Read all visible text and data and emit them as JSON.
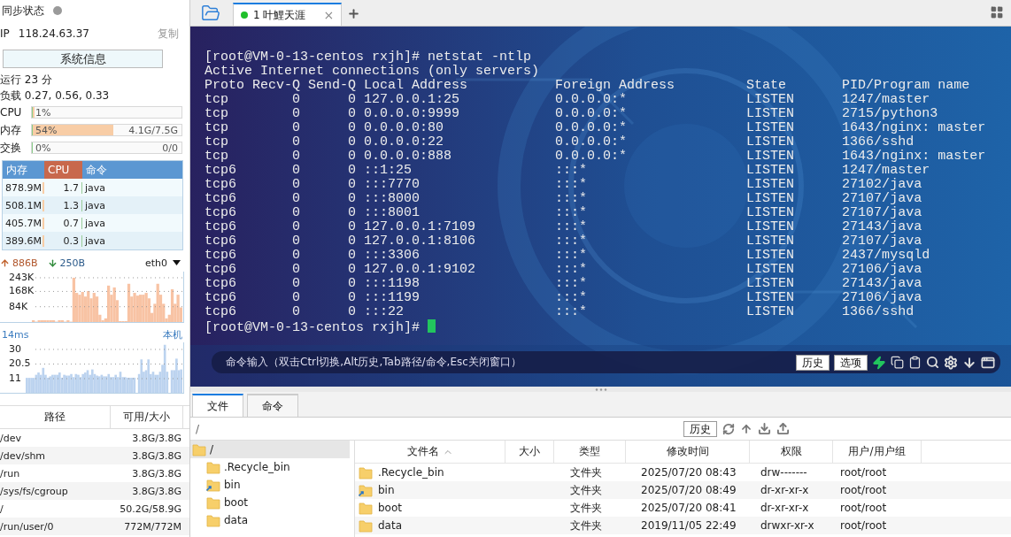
{
  "sidebar": {
    "sync": {
      "label": "同步状态",
      "color": "#9a9a9a"
    },
    "ip": {
      "label": "IP",
      "value": "118.24.63.37",
      "copy": "复制"
    },
    "sysinfo_button": "系统信息",
    "uptime": "运行 23 分",
    "load": "负载 0.27, 0.56, 0.33",
    "meters": [
      {
        "label": "CPU",
        "reading": "1%",
        "level": 0.01
      },
      {
        "label": "内存",
        "reading": "54%",
        "detail": "4.1G/7.5G",
        "level": 0.54
      },
      {
        "label": "交换",
        "reading": "0%",
        "detail": "0/0",
        "level": 0
      }
    ],
    "processes": {
      "columns": [
        {
          "label": "内存",
          "selected": false
        },
        {
          "label": "CPU",
          "selected": true
        },
        {
          "label": "命令",
          "selected": false
        }
      ],
      "rows": [
        [
          "878.9M",
          "1.7",
          "java"
        ],
        [
          "508.1M",
          "1.3",
          "java"
        ],
        [
          "405.7M",
          "0.7",
          "java"
        ],
        [
          "389.6M",
          "0.3",
          "java"
        ]
      ]
    },
    "network": {
      "upload": "886B",
      "download": "250B",
      "interface": "eth0",
      "axis_labels": [
        "243K",
        "168K",
        "84K"
      ]
    },
    "ping": {
      "latency": "14ms",
      "target": "本机",
      "axis_labels": [
        "30",
        "20.5",
        "11"
      ]
    },
    "disks": {
      "columns": [
        "路径",
        "可用/大小"
      ],
      "rows": [
        [
          "/dev",
          "3.8G/3.8G"
        ],
        [
          "/dev/shm",
          "3.8G/3.8G"
        ],
        [
          "/run",
          "3.8G/3.8G"
        ],
        [
          "/sys/fs/cgroup",
          "3.8G/3.8G"
        ],
        [
          "/",
          "50.2G/58.9G"
        ],
        [
          "/run/user/0",
          "772M/772M"
        ]
      ]
    }
  },
  "session_tabs": [
    {
      "label": "1 叶鯉天涯",
      "color": "#1fbf2a",
      "close": "×",
      "selected": true
    }
  ],
  "terminal": {
    "prompt": "[root@VM-0-13-centos rxjh]# ",
    "command": "netstat -ntlp",
    "final_prompt": "[root@VM-0-13-centos rxjh]# ",
    "output": [
      "Active Internet connections (only servers)",
      "Proto Recv-Q Send-Q Local Address           Foreign Address         State       PID/Program name"
    ],
    "rows": [
      [
        "tcp",
        "0",
        "0",
        "127.0.0.1:25",
        "0.0.0.0:*",
        "LISTEN",
        "1247/master"
      ],
      [
        "tcp",
        "0",
        "0",
        "0.0.0.0:9999",
        "0.0.0.0:*",
        "LISTEN",
        "2715/python3"
      ],
      [
        "tcp",
        "0",
        "0",
        "0.0.0.0:80",
        "0.0.0.0:*",
        "LISTEN",
        "1643/nginx: master"
      ],
      [
        "tcp",
        "0",
        "0",
        "0.0.0.0:22",
        "0.0.0.0:*",
        "LISTEN",
        "1366/sshd"
      ],
      [
        "tcp",
        "0",
        "0",
        "0.0.0.0:888",
        "0.0.0.0:*",
        "LISTEN",
        "1643/nginx: master"
      ],
      [
        "tcp6",
        "0",
        "0",
        "::1:25",
        ":::*",
        "LISTEN",
        "1247/master"
      ],
      [
        "tcp6",
        "0",
        "0",
        ":::7770",
        ":::*",
        "LISTEN",
        "27102/java"
      ],
      [
        "tcp6",
        "0",
        "0",
        ":::8000",
        ":::*",
        "LISTEN",
        "27107/java"
      ],
      [
        "tcp6",
        "0",
        "0",
        ":::8001",
        ":::*",
        "LISTEN",
        "27107/java"
      ],
      [
        "tcp6",
        "0",
        "0",
        "127.0.0.1:7109",
        ":::*",
        "LISTEN",
        "27143/java"
      ],
      [
        "tcp6",
        "0",
        "0",
        "127.0.0.1:8106",
        ":::*",
        "LISTEN",
        "27107/java"
      ],
      [
        "tcp6",
        "0",
        "0",
        ":::3306",
        ":::*",
        "LISTEN",
        "2437/mysqld"
      ],
      [
        "tcp6",
        "0",
        "0",
        "127.0.0.1:9102",
        ":::*",
        "LISTEN",
        "27106/java"
      ],
      [
        "tcp6",
        "0",
        "0",
        ":::1198",
        ":::*",
        "LISTEN",
        "27143/java"
      ],
      [
        "tcp6",
        "0",
        "0",
        ":::1199",
        ":::*",
        "LISTEN",
        "27106/java"
      ],
      [
        "tcp6",
        "0",
        "0",
        ":::22",
        ":::*",
        "LISTEN",
        "1366/sshd"
      ]
    ]
  },
  "command_bar": {
    "hint": "命令输入（双击Ctrl切换,Alt历史,Tab路径/命令,Esc关闭窗口）",
    "buttons": [
      "历史",
      "选项"
    ]
  },
  "bottom_tabs": [
    {
      "label": "文件",
      "selected": true
    },
    {
      "label": "命令",
      "selected": false
    }
  ],
  "path_bar": {
    "path": "/",
    "history_button": "历史"
  },
  "tree": [
    {
      "label": "/",
      "selected": true,
      "link": false,
      "children": [
        {
          "label": ".Recycle_bin",
          "selected": false,
          "link": false
        },
        {
          "label": "bin",
          "selected": false,
          "link": true
        },
        {
          "label": "boot",
          "selected": false,
          "link": false
        },
        {
          "label": "data",
          "selected": false,
          "link": false
        }
      ]
    }
  ],
  "files": {
    "columns": [
      "文件名",
      "大小",
      "类型",
      "修改时间",
      "权限",
      "用户/用户组"
    ],
    "rows": [
      {
        "name": ".Recycle_bin",
        "link": false,
        "type": "文件夹",
        "modified": "2025/07/20 08:43",
        "perms": "drw-------",
        "owner": "root/root"
      },
      {
        "name": "bin",
        "link": true,
        "type": "文件夹",
        "modified": "2025/07/20 08:49",
        "perms": "dr-xr-xr-x",
        "owner": "root/root"
      },
      {
        "name": "boot",
        "link": false,
        "type": "文件夹",
        "modified": "2025/07/20 08:41",
        "perms": "dr-xr-xr-x",
        "owner": "root/root"
      },
      {
        "name": "data",
        "link": false,
        "type": "文件夹",
        "modified": "2019/11/05 22:49",
        "perms": "drwxr-xr-x",
        "owner": "root/root"
      }
    ]
  }
}
